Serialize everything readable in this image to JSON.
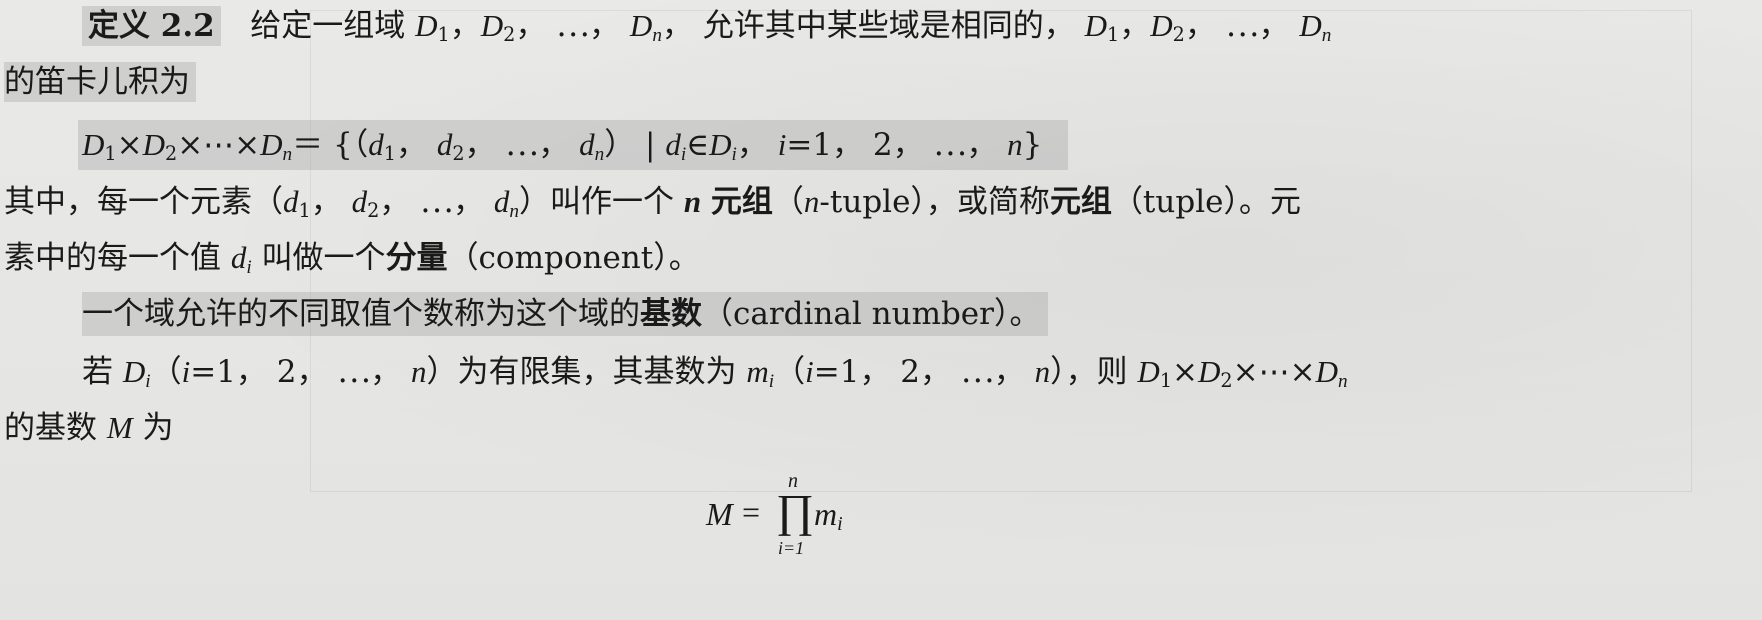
{
  "definition": {
    "label": "定义 2.2",
    "intro": "给定一组域",
    "mid": "允许其中某些域是相同的，",
    "l2": "的笛卡儿积为"
  },
  "cartesian": {
    "lhs": "D₁×D₂×⋯×Dₙ＝",
    "rhs": "{(d₁， d₂， ⋯， dₙ) ｜dᵢ∈Dᵢ， i=1， 2， ⋯， n}"
  },
  "tuple": {
    "l1a": "其中，每一个元素（",
    "l1b": "）叫作一个",
    "n": "n",
    "term": "元组",
    "l1c": "（",
    "ntuple": "n",
    "ntuple_rest": "-tuple），或简称",
    "term2": "元组",
    "l1d": "（tuple）。元",
    "l2a": "素中的每一个值",
    "l2b": "叫做一个",
    "term3": "分量",
    "l2c": "（component）。"
  },
  "cardinal": {
    "text": "一个域允许的不同取值个数称为这个域的",
    "term": "基数",
    "rest": "（cardinal number）。"
  },
  "finite": {
    "l1a": "若",
    "l1b": "为有限集，其基数为",
    "l1c": "，则",
    "l2": "的基数",
    "M": "M",
    "l2end": "为"
  },
  "formula": {
    "M": "M",
    "eq": "=",
    "prod": "∏",
    "upper": "n",
    "lower": "i=1",
    "term": "m",
    "sub": "i"
  }
}
